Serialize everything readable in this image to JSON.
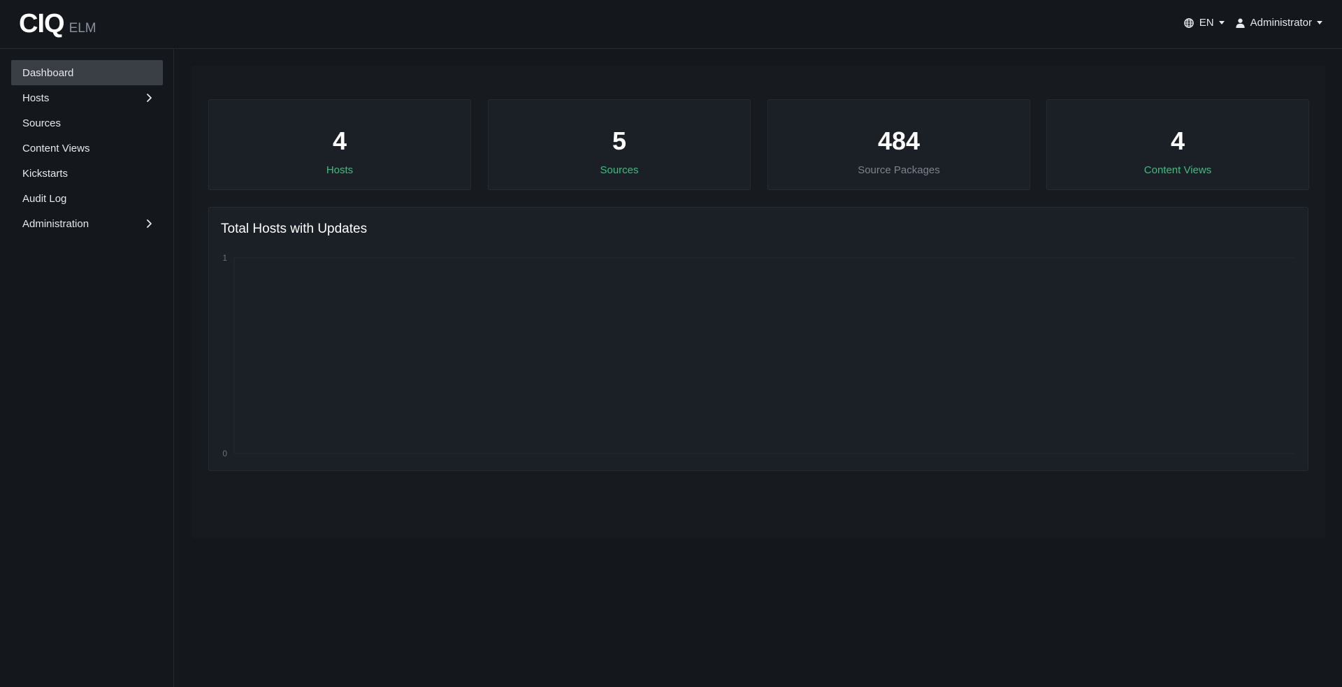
{
  "header": {
    "logo_main": "CIQ",
    "logo_sub": "ELM",
    "language": "EN",
    "user": "Administrator"
  },
  "sidebar": {
    "items": [
      {
        "label": "Dashboard",
        "active": true,
        "has_children": false
      },
      {
        "label": "Hosts",
        "active": false,
        "has_children": true
      },
      {
        "label": "Sources",
        "active": false,
        "has_children": false
      },
      {
        "label": "Content Views",
        "active": false,
        "has_children": false
      },
      {
        "label": "Kickstarts",
        "active": false,
        "has_children": false
      },
      {
        "label": "Audit Log",
        "active": false,
        "has_children": false
      },
      {
        "label": "Administration",
        "active": false,
        "has_children": true
      }
    ]
  },
  "stats": [
    {
      "value": "4",
      "label": "Hosts",
      "link": true
    },
    {
      "value": "5",
      "label": "Sources",
      "link": true
    },
    {
      "value": "484",
      "label": "Source Packages",
      "link": false
    },
    {
      "value": "4",
      "label": "Content Views",
      "link": true
    }
  ],
  "chart": {
    "title": "Total Hosts with Updates"
  },
  "chart_data": {
    "type": "line",
    "title": "Total Hosts with Updates",
    "xlabel": "",
    "ylabel": "",
    "ylim": [
      0,
      1
    ],
    "y_ticks": [
      "1",
      "0"
    ],
    "series": [],
    "grid": true
  },
  "colors": {
    "background": "#14171c",
    "card": "#1b1f26",
    "accent_green": "#3dbd7d",
    "muted": "#7d838c",
    "active_nav": "#3a3e45"
  }
}
